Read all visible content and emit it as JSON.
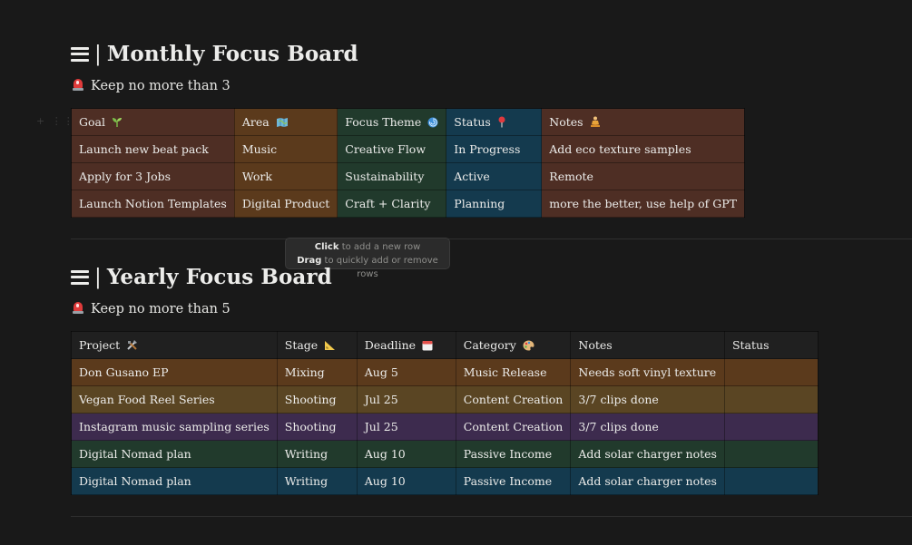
{
  "colors": {
    "background": "#191919",
    "brown": "#4e2e24",
    "orange": "#5b3a1c",
    "green": "#213a2c",
    "blue": "#143a4e",
    "purple": "#3d2b4e",
    "yellow": "#5a4523",
    "gray": "#202020"
  },
  "monthly": {
    "title": "Monthly Focus Board",
    "note": "Keep no more than 3",
    "columns": [
      {
        "label": "Goal",
        "icon": "seedling-icon"
      },
      {
        "label": "Area",
        "icon": "map-icon"
      },
      {
        "label": "Focus Theme",
        "icon": "cyclone-icon"
      },
      {
        "label": "Status",
        "icon": "pin-icon"
      },
      {
        "label": "Notes",
        "icon": "meditation-icon"
      }
    ],
    "rows": [
      [
        "Launch new beat pack",
        "Music",
        "Creative Flow",
        "In Progress",
        "Add eco texture samples"
      ],
      [
        "Apply for 3 Jobs",
        "Work",
        "Sustainability",
        "Active",
        "Remote"
      ],
      [
        "Launch Notion Templates",
        "Digital Product",
        "Craft + Clarity",
        "Planning",
        "more the better, use help of GPT"
      ]
    ]
  },
  "tooltip": {
    "line1_bold": "Click",
    "line1_rest": "to add a new row",
    "line2_bold": "Drag",
    "line2_rest": "to quickly add or remove rows"
  },
  "yearly": {
    "title": "Yearly Focus Board",
    "note": "Keep no more than 5",
    "columns": [
      {
        "label": "Project",
        "icon": "tools-icon"
      },
      {
        "label": "Stage",
        "icon": "ruler-icon"
      },
      {
        "label": "Deadline",
        "icon": "calendar-icon"
      },
      {
        "label": "Category",
        "icon": "palette-icon"
      },
      {
        "label": "Notes",
        "icon": ""
      },
      {
        "label": "Status",
        "icon": ""
      }
    ],
    "rows": [
      [
        "Don Gusano EP",
        "Mixing",
        "Aug 5",
        "Music Release",
        "Needs soft vinyl texture",
        ""
      ],
      [
        "Vegan Food Reel Series",
        "Shooting",
        "Jul 25",
        "Content Creation",
        "3/7 clips done",
        ""
      ],
      [
        "Instagram music sampling series",
        "Shooting",
        "Jul 25",
        "Content Creation",
        "3/7 clips done",
        ""
      ],
      [
        "Digital Nomad plan",
        "Writing",
        "Aug 10",
        "Passive Income",
        "Add solar charger notes",
        ""
      ],
      [
        "Digital Nomad plan",
        "Writing",
        "Aug 10",
        "Passive Income",
        "Add solar charger notes",
        ""
      ]
    ]
  }
}
